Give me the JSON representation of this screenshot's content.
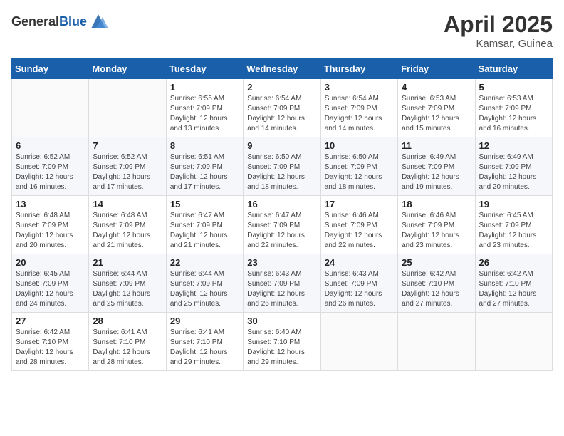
{
  "logo": {
    "general": "General",
    "blue": "Blue"
  },
  "title": "April 2025",
  "location": "Kamsar, Guinea",
  "days_of_week": [
    "Sunday",
    "Monday",
    "Tuesday",
    "Wednesday",
    "Thursday",
    "Friday",
    "Saturday"
  ],
  "weeks": [
    [
      {
        "day": "",
        "info": ""
      },
      {
        "day": "",
        "info": ""
      },
      {
        "day": "1",
        "info": "Sunrise: 6:55 AM\nSunset: 7:09 PM\nDaylight: 12 hours and 13 minutes."
      },
      {
        "day": "2",
        "info": "Sunrise: 6:54 AM\nSunset: 7:09 PM\nDaylight: 12 hours and 14 minutes."
      },
      {
        "day": "3",
        "info": "Sunrise: 6:54 AM\nSunset: 7:09 PM\nDaylight: 12 hours and 14 minutes."
      },
      {
        "day": "4",
        "info": "Sunrise: 6:53 AM\nSunset: 7:09 PM\nDaylight: 12 hours and 15 minutes."
      },
      {
        "day": "5",
        "info": "Sunrise: 6:53 AM\nSunset: 7:09 PM\nDaylight: 12 hours and 16 minutes."
      }
    ],
    [
      {
        "day": "6",
        "info": "Sunrise: 6:52 AM\nSunset: 7:09 PM\nDaylight: 12 hours and 16 minutes."
      },
      {
        "day": "7",
        "info": "Sunrise: 6:52 AM\nSunset: 7:09 PM\nDaylight: 12 hours and 17 minutes."
      },
      {
        "day": "8",
        "info": "Sunrise: 6:51 AM\nSunset: 7:09 PM\nDaylight: 12 hours and 17 minutes."
      },
      {
        "day": "9",
        "info": "Sunrise: 6:50 AM\nSunset: 7:09 PM\nDaylight: 12 hours and 18 minutes."
      },
      {
        "day": "10",
        "info": "Sunrise: 6:50 AM\nSunset: 7:09 PM\nDaylight: 12 hours and 18 minutes."
      },
      {
        "day": "11",
        "info": "Sunrise: 6:49 AM\nSunset: 7:09 PM\nDaylight: 12 hours and 19 minutes."
      },
      {
        "day": "12",
        "info": "Sunrise: 6:49 AM\nSunset: 7:09 PM\nDaylight: 12 hours and 20 minutes."
      }
    ],
    [
      {
        "day": "13",
        "info": "Sunrise: 6:48 AM\nSunset: 7:09 PM\nDaylight: 12 hours and 20 minutes."
      },
      {
        "day": "14",
        "info": "Sunrise: 6:48 AM\nSunset: 7:09 PM\nDaylight: 12 hours and 21 minutes."
      },
      {
        "day": "15",
        "info": "Sunrise: 6:47 AM\nSunset: 7:09 PM\nDaylight: 12 hours and 21 minutes."
      },
      {
        "day": "16",
        "info": "Sunrise: 6:47 AM\nSunset: 7:09 PM\nDaylight: 12 hours and 22 minutes."
      },
      {
        "day": "17",
        "info": "Sunrise: 6:46 AM\nSunset: 7:09 PM\nDaylight: 12 hours and 22 minutes."
      },
      {
        "day": "18",
        "info": "Sunrise: 6:46 AM\nSunset: 7:09 PM\nDaylight: 12 hours and 23 minutes."
      },
      {
        "day": "19",
        "info": "Sunrise: 6:45 AM\nSunset: 7:09 PM\nDaylight: 12 hours and 23 minutes."
      }
    ],
    [
      {
        "day": "20",
        "info": "Sunrise: 6:45 AM\nSunset: 7:09 PM\nDaylight: 12 hours and 24 minutes."
      },
      {
        "day": "21",
        "info": "Sunrise: 6:44 AM\nSunset: 7:09 PM\nDaylight: 12 hours and 25 minutes."
      },
      {
        "day": "22",
        "info": "Sunrise: 6:44 AM\nSunset: 7:09 PM\nDaylight: 12 hours and 25 minutes."
      },
      {
        "day": "23",
        "info": "Sunrise: 6:43 AM\nSunset: 7:09 PM\nDaylight: 12 hours and 26 minutes."
      },
      {
        "day": "24",
        "info": "Sunrise: 6:43 AM\nSunset: 7:09 PM\nDaylight: 12 hours and 26 minutes."
      },
      {
        "day": "25",
        "info": "Sunrise: 6:42 AM\nSunset: 7:10 PM\nDaylight: 12 hours and 27 minutes."
      },
      {
        "day": "26",
        "info": "Sunrise: 6:42 AM\nSunset: 7:10 PM\nDaylight: 12 hours and 27 minutes."
      }
    ],
    [
      {
        "day": "27",
        "info": "Sunrise: 6:42 AM\nSunset: 7:10 PM\nDaylight: 12 hours and 28 minutes."
      },
      {
        "day": "28",
        "info": "Sunrise: 6:41 AM\nSunset: 7:10 PM\nDaylight: 12 hours and 28 minutes."
      },
      {
        "day": "29",
        "info": "Sunrise: 6:41 AM\nSunset: 7:10 PM\nDaylight: 12 hours and 29 minutes."
      },
      {
        "day": "30",
        "info": "Sunrise: 6:40 AM\nSunset: 7:10 PM\nDaylight: 12 hours and 29 minutes."
      },
      {
        "day": "",
        "info": ""
      },
      {
        "day": "",
        "info": ""
      },
      {
        "day": "",
        "info": ""
      }
    ]
  ]
}
